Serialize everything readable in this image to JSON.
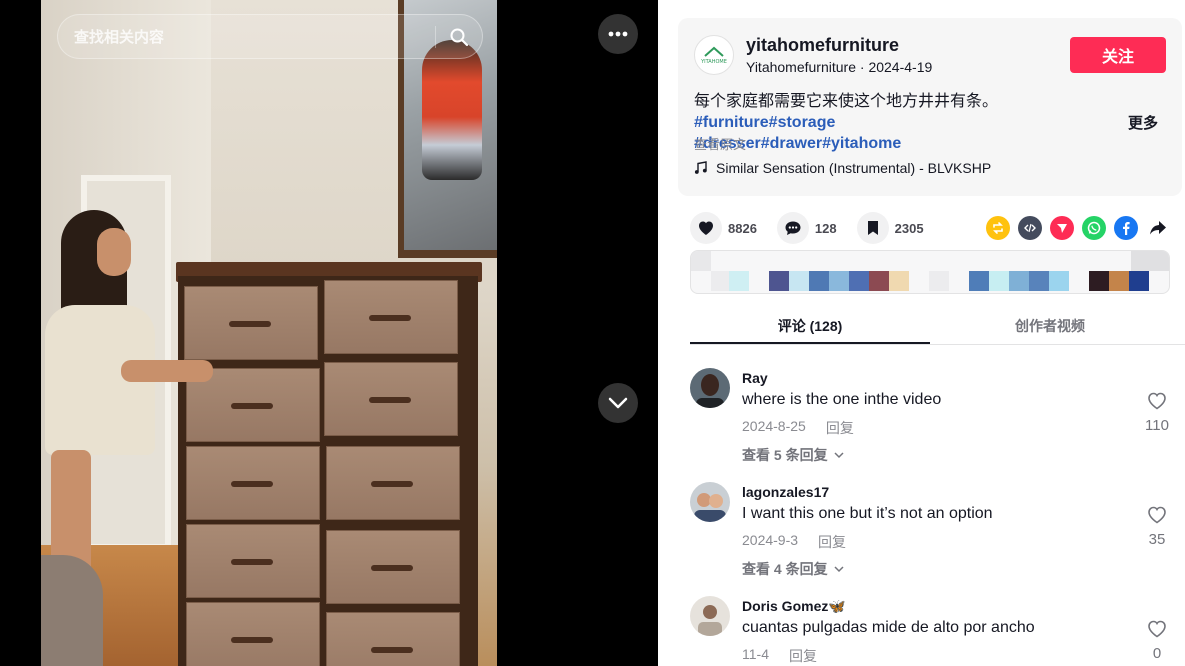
{
  "search": {
    "placeholder": "查找相关内容"
  },
  "author": {
    "username": "yitahomefurniture",
    "nickname": "Yitahomefurniture",
    "date": "2024-4-19",
    "logo_text": "YITAHOME",
    "follow_label": "关注"
  },
  "description": {
    "text": "每个家庭都需要它来使这个地方井井有条。",
    "tags": [
      "#furniture",
      "#storage",
      "#dresser",
      "#drawer",
      "#yitahome"
    ],
    "more_label": "更多",
    "see_original": "查看原文"
  },
  "music": {
    "title": "Similar Sensation (Instrumental) - BLVKSHP"
  },
  "stats": {
    "likes": "8826",
    "comments": "128",
    "saves": "2305"
  },
  "share_icons": [
    "repost-icon",
    "embed-icon",
    "send-icon",
    "whatsapp-icon",
    "facebook-icon",
    "share-arrow-icon"
  ],
  "colors": {
    "accent": "#fe2c55",
    "tag": "#2b5db9",
    "repost": "#ffc20e",
    "embed": "#444b5d",
    "send": "#fe2c55",
    "whatsapp": "#25d366",
    "facebook": "#1877f2"
  },
  "tabs": [
    {
      "label": "评论 (128)",
      "active": true
    },
    {
      "label": "创作者视频",
      "active": false
    }
  ],
  "comments": [
    {
      "user": "Ray",
      "text": "where is the one inthe video",
      "date": "2024-8-25",
      "reply": "回复",
      "likes": "110",
      "view_replies": "查看 5 条回复"
    },
    {
      "user": "lagonzales17",
      "text": "I want this one but it’s not an option",
      "date": "2024-9-3",
      "reply": "回复",
      "likes": "35",
      "view_replies": "查看 4 条回复"
    },
    {
      "user": "Doris Gomez🦋",
      "text": "cuantas pulgadas mide de alto por ancho",
      "date": "11-4",
      "reply": "回复",
      "likes": "0"
    }
  ]
}
